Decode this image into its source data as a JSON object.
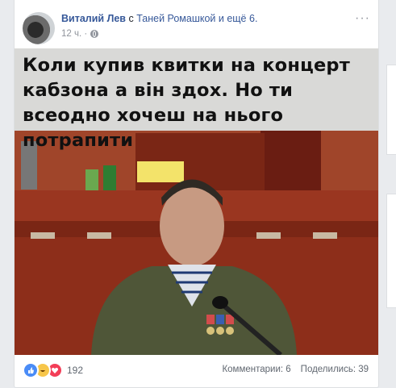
{
  "post": {
    "author": "Виталий Лев",
    "with_prefix": "с",
    "with_names": "Таней Ромашкой и ещё 6.",
    "time": "12 ч. ·",
    "more_label": "···",
    "image_caption": "Коли купив квитки на концерт кабзона а він здох. Но ти всеодно хочеш на нього потрапити"
  },
  "footer": {
    "reactions": [
      "like-icon",
      "haha-icon",
      "love-icon"
    ],
    "reactions_count": "192",
    "comments": "Комментарии: 6",
    "shares": "Поделились: 39"
  },
  "colors": {
    "link": "#365899",
    "meta": "#90949c",
    "wall_red": "#8b2a1a",
    "podium": "#9a3620",
    "jacket": "#4f5638"
  }
}
